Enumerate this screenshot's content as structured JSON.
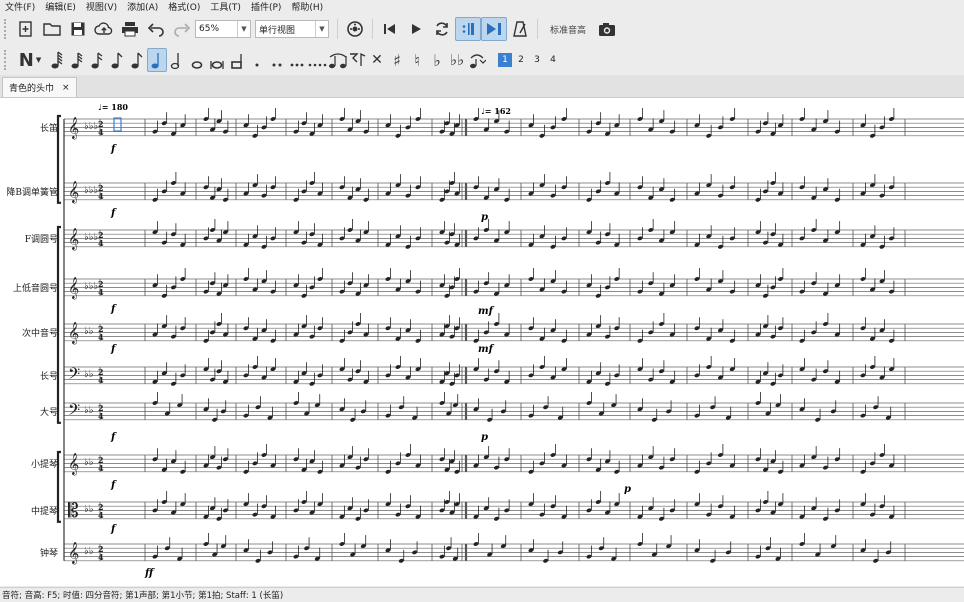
{
  "menu": [
    "文件(F)",
    "编辑(E)",
    "视图(V)",
    "添加(A)",
    "格式(O)",
    "工具(T)",
    "插件(P)",
    "帮助(H)"
  ],
  "toolbar": {
    "zoom": "65%",
    "view_mode": "单行视图",
    "standard_concert_label": "标准音高"
  },
  "note_input": {
    "voices": [
      "1",
      "2",
      "3",
      "4"
    ]
  },
  "tab": {
    "title": "青色的头巾",
    "close": "×"
  },
  "score": {
    "tempo_1": "♩= 180",
    "tempo_2": "♩= 162",
    "instruments": [
      "长笛",
      "降B调单簧管",
      "F调圆号",
      "上低音圆号",
      "次中音号",
      "长号",
      "大号",
      "小提琴",
      "中提琴",
      "钟琴"
    ],
    "dynamics": {
      "f": "f",
      "p": "p",
      "mf": "mf",
      "ff": "ff"
    }
  },
  "status": "音符; 音高: F5; 时值: 四分音符; 第1声部; 第1小节; 第1拍; Staff: 1 (长笛)"
}
